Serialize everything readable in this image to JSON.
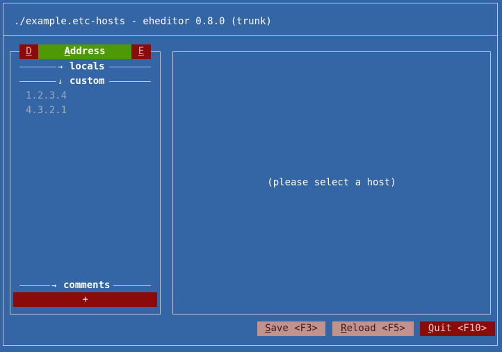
{
  "window": {
    "title": "./example.etc-hosts - eheditor 0.8.0 (trunk)"
  },
  "left_panel": {
    "header": {
      "d_button": "D",
      "address_first_letter": "A",
      "address_rest": "ddress",
      "e_button": "E"
    },
    "groups": [
      {
        "arrow": "→",
        "name": "locals"
      },
      {
        "arrow": "↓",
        "name": "custom"
      }
    ],
    "hosts": [
      "1.2.3.4",
      "4.3.2.1"
    ],
    "comments_group": {
      "arrow": "→",
      "name": "comments"
    },
    "add_button": "+"
  },
  "right_panel": {
    "placeholder": "(please select a host)"
  },
  "footer": {
    "save": {
      "key": "S",
      "rest": "ave <F3>"
    },
    "reload": {
      "key": "R",
      "rest": "eload <F5>"
    },
    "quit": {
      "key": "Q",
      "rest": "uit <F10>"
    }
  },
  "colors": {
    "background": "#3465a4",
    "border": "#b8c6da",
    "active_green": "#4e9a06",
    "button_red": "#8b0a0a",
    "button_disabled": "#c2928f",
    "muted_text": "#9aa9bf"
  }
}
